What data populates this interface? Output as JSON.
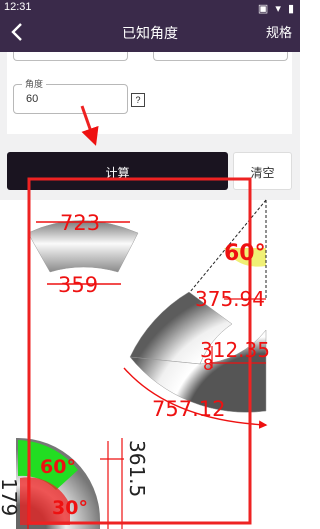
{
  "status": {
    "time": "12:31"
  },
  "header": {
    "title": "已知角度",
    "right_action": "规格"
  },
  "form": {
    "angle_label": "角度",
    "angle_value": "60",
    "help_mark": "?"
  },
  "buttons": {
    "calculate": "计算",
    "clear": "清空"
  },
  "drawings": {
    "trapezoid_top": "723",
    "trapezoid_bottom": "359",
    "sector_angle": "60°",
    "sector_outer_top": "375.94",
    "sector_inner": "312.35",
    "sector_small": "8",
    "sector_arc": "757.12",
    "elbow_angle_60": "60°",
    "elbow_angle_30": "30°",
    "elbow_dim_vertical": "361.5",
    "elbow_dim_left": "179"
  },
  "colors": {
    "header_bg": "#3a2a4a",
    "annotation_red": "#ee1111",
    "highlight_green": "#22dd22",
    "highlight_yellow": "#eeee55"
  }
}
